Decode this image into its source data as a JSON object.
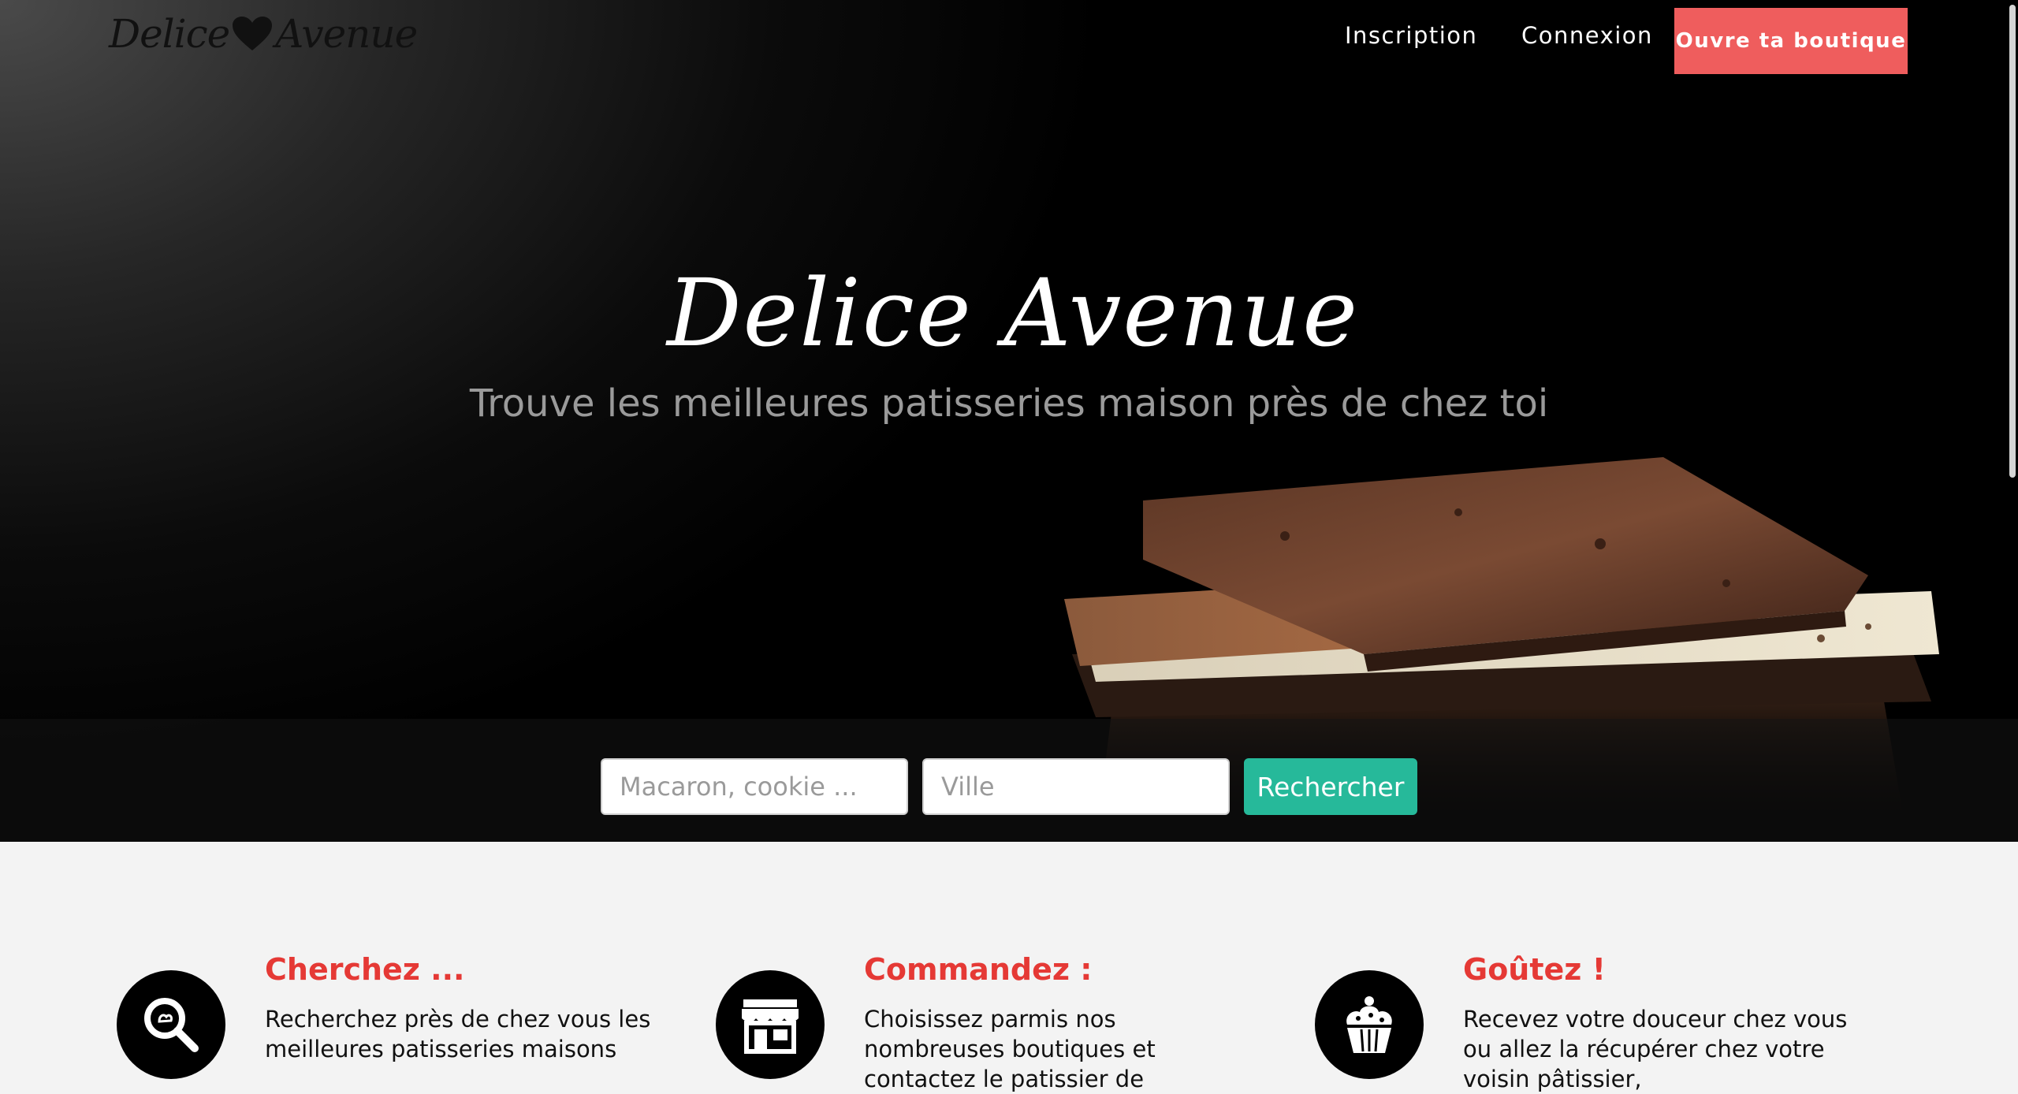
{
  "brand": {
    "logo_left": "Delice",
    "logo_right": "Avenue"
  },
  "nav": {
    "inscription": "Inscription",
    "connexion": "Connexion",
    "cta": "Ouvre ta boutique"
  },
  "hero": {
    "title": "Delice Avenue",
    "subtitle": "Trouve les meilleures patisseries maison près de chez toi"
  },
  "search": {
    "query_placeholder": "Macaron, cookie ...",
    "city_placeholder": "Ville",
    "button": "Rechercher"
  },
  "features": [
    {
      "icon": "search-icon",
      "title": "Cherchez ...",
      "text": "Recherchez près de chez vous les meilleures patisseries maisons"
    },
    {
      "icon": "shop-icon",
      "title": "Commandez :",
      "text": "Choisissez parmis nos nombreuses boutiques et contactez le patissier de"
    },
    {
      "icon": "cupcake-icon",
      "title": "Goûtez !",
      "text": "Recevez votre douceur chez vous ou allez la récupérer chez votre voisin pâtissier,"
    }
  ],
  "colors": {
    "accent": "#ef5d5d",
    "search_button": "#26b99a",
    "feature_title": "#e53935"
  }
}
